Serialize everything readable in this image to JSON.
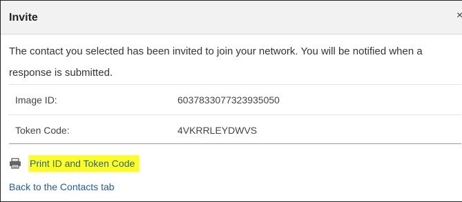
{
  "dialog": {
    "title": "Invite",
    "close_label": "×"
  },
  "message": {
    "line1": "The contact you selected has been invited to join your network. You will be notified when a",
    "line2": "response is submitted."
  },
  "details": {
    "image_id_label": "Image ID:",
    "image_id_value": "6037833077323935050",
    "token_code_label": "Token Code:",
    "token_code_value": "4VKRRLEYDWVS"
  },
  "actions": {
    "print_icon": "printer-icon",
    "print_label": "Print ID and Token Code",
    "back_label": "Back to the Contacts tab"
  },
  "colors": {
    "link": "#1a5fa8",
    "highlight": "#ffff22",
    "header_bg": "#f2f2f2"
  }
}
